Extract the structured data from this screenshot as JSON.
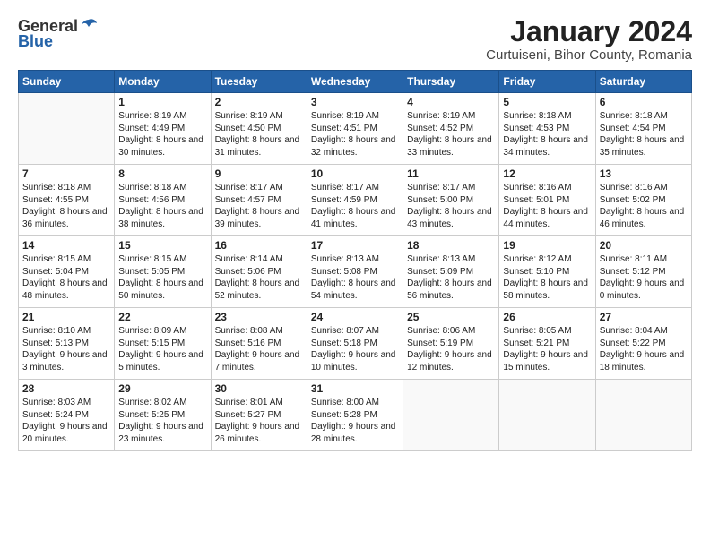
{
  "header": {
    "logo_line1": "General",
    "logo_line2": "Blue",
    "month_title": "January 2024",
    "location": "Curtuiseni, Bihor County, Romania"
  },
  "days_of_week": [
    "Sunday",
    "Monday",
    "Tuesday",
    "Wednesday",
    "Thursday",
    "Friday",
    "Saturday"
  ],
  "weeks": [
    [
      {
        "day": "",
        "sunrise": "",
        "sunset": "",
        "daylight": ""
      },
      {
        "day": "1",
        "sunrise": "8:19 AM",
        "sunset": "4:49 PM",
        "daylight": "8 hours and 30 minutes."
      },
      {
        "day": "2",
        "sunrise": "8:19 AM",
        "sunset": "4:50 PM",
        "daylight": "8 hours and 31 minutes."
      },
      {
        "day": "3",
        "sunrise": "8:19 AM",
        "sunset": "4:51 PM",
        "daylight": "8 hours and 32 minutes."
      },
      {
        "day": "4",
        "sunrise": "8:19 AM",
        "sunset": "4:52 PM",
        "daylight": "8 hours and 33 minutes."
      },
      {
        "day": "5",
        "sunrise": "8:18 AM",
        "sunset": "4:53 PM",
        "daylight": "8 hours and 34 minutes."
      },
      {
        "day": "6",
        "sunrise": "8:18 AM",
        "sunset": "4:54 PM",
        "daylight": "8 hours and 35 minutes."
      }
    ],
    [
      {
        "day": "7",
        "sunrise": "8:18 AM",
        "sunset": "4:55 PM",
        "daylight": "8 hours and 36 minutes."
      },
      {
        "day": "8",
        "sunrise": "8:18 AM",
        "sunset": "4:56 PM",
        "daylight": "8 hours and 38 minutes."
      },
      {
        "day": "9",
        "sunrise": "8:17 AM",
        "sunset": "4:57 PM",
        "daylight": "8 hours and 39 minutes."
      },
      {
        "day": "10",
        "sunrise": "8:17 AM",
        "sunset": "4:59 PM",
        "daylight": "8 hours and 41 minutes."
      },
      {
        "day": "11",
        "sunrise": "8:17 AM",
        "sunset": "5:00 PM",
        "daylight": "8 hours and 43 minutes."
      },
      {
        "day": "12",
        "sunrise": "8:16 AM",
        "sunset": "5:01 PM",
        "daylight": "8 hours and 44 minutes."
      },
      {
        "day": "13",
        "sunrise": "8:16 AM",
        "sunset": "5:02 PM",
        "daylight": "8 hours and 46 minutes."
      }
    ],
    [
      {
        "day": "14",
        "sunrise": "8:15 AM",
        "sunset": "5:04 PM",
        "daylight": "8 hours and 48 minutes."
      },
      {
        "day": "15",
        "sunrise": "8:15 AM",
        "sunset": "5:05 PM",
        "daylight": "8 hours and 50 minutes."
      },
      {
        "day": "16",
        "sunrise": "8:14 AM",
        "sunset": "5:06 PM",
        "daylight": "8 hours and 52 minutes."
      },
      {
        "day": "17",
        "sunrise": "8:13 AM",
        "sunset": "5:08 PM",
        "daylight": "8 hours and 54 minutes."
      },
      {
        "day": "18",
        "sunrise": "8:13 AM",
        "sunset": "5:09 PM",
        "daylight": "8 hours and 56 minutes."
      },
      {
        "day": "19",
        "sunrise": "8:12 AM",
        "sunset": "5:10 PM",
        "daylight": "8 hours and 58 minutes."
      },
      {
        "day": "20",
        "sunrise": "8:11 AM",
        "sunset": "5:12 PM",
        "daylight": "9 hours and 0 minutes."
      }
    ],
    [
      {
        "day": "21",
        "sunrise": "8:10 AM",
        "sunset": "5:13 PM",
        "daylight": "9 hours and 3 minutes."
      },
      {
        "day": "22",
        "sunrise": "8:09 AM",
        "sunset": "5:15 PM",
        "daylight": "9 hours and 5 minutes."
      },
      {
        "day": "23",
        "sunrise": "8:08 AM",
        "sunset": "5:16 PM",
        "daylight": "9 hours and 7 minutes."
      },
      {
        "day": "24",
        "sunrise": "8:07 AM",
        "sunset": "5:18 PM",
        "daylight": "9 hours and 10 minutes."
      },
      {
        "day": "25",
        "sunrise": "8:06 AM",
        "sunset": "5:19 PM",
        "daylight": "9 hours and 12 minutes."
      },
      {
        "day": "26",
        "sunrise": "8:05 AM",
        "sunset": "5:21 PM",
        "daylight": "9 hours and 15 minutes."
      },
      {
        "day": "27",
        "sunrise": "8:04 AM",
        "sunset": "5:22 PM",
        "daylight": "9 hours and 18 minutes."
      }
    ],
    [
      {
        "day": "28",
        "sunrise": "8:03 AM",
        "sunset": "5:24 PM",
        "daylight": "9 hours and 20 minutes."
      },
      {
        "day": "29",
        "sunrise": "8:02 AM",
        "sunset": "5:25 PM",
        "daylight": "9 hours and 23 minutes."
      },
      {
        "day": "30",
        "sunrise": "8:01 AM",
        "sunset": "5:27 PM",
        "daylight": "9 hours and 26 minutes."
      },
      {
        "day": "31",
        "sunrise": "8:00 AM",
        "sunset": "5:28 PM",
        "daylight": "9 hours and 28 minutes."
      },
      {
        "day": "",
        "sunrise": "",
        "sunset": "",
        "daylight": ""
      },
      {
        "day": "",
        "sunrise": "",
        "sunset": "",
        "daylight": ""
      },
      {
        "day": "",
        "sunrise": "",
        "sunset": "",
        "daylight": ""
      }
    ]
  ]
}
